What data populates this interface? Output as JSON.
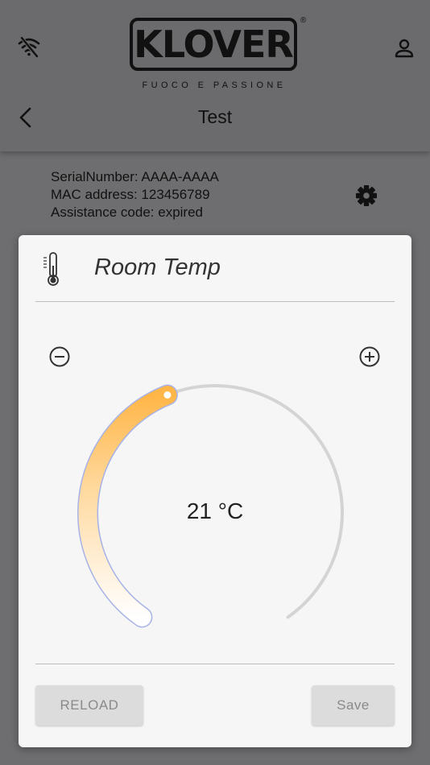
{
  "header": {
    "logo_word": "KLOVER",
    "logo_reg": "®",
    "logo_tagline": "FUOCO E PASSIONE",
    "title": "Test"
  },
  "device": {
    "serial": "SerialNumber: AAAA-AAAA",
    "mac": "MAC address: 123456789",
    "assistance": "Assistance code: expired"
  },
  "dialog": {
    "title": "Room Temp",
    "temperature": "21 °C",
    "reload_label": "RELOAD",
    "save_label": "Save"
  },
  "dial": {
    "min": 7,
    "max": 40,
    "value": 21
  },
  "icons": {
    "wifi": "wifi-off-icon",
    "user": "user-icon",
    "back": "chevron-left-icon",
    "gear": "gear-icon",
    "thermometer": "thermometer-icon",
    "minus": "minus-circle-icon",
    "plus": "plus-circle-icon"
  },
  "colors": {
    "header_bg": "#6b6b6d",
    "dialog_bg": "#f6f6f6",
    "accent_orange": "#ffbb55",
    "track": "#d4d4d4",
    "button_bg": "#dcdcdc"
  }
}
